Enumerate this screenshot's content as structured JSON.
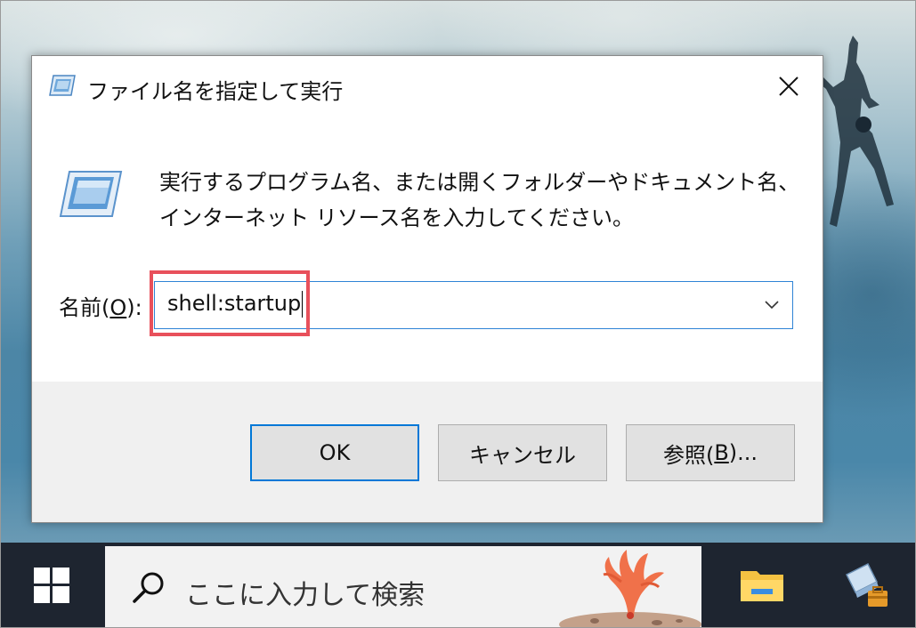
{
  "dialog": {
    "title": "ファイル名を指定して実行",
    "description": "実行するプログラム名、または開くフォルダーやドキュメント名、インターネット リソース名を入力してください。",
    "name_label_prefix": "名前(",
    "name_label_key": "O",
    "name_label_suffix": "):",
    "command_value": "shell:startup",
    "buttons": {
      "ok": "OK",
      "cancel": "キャンセル",
      "browse_prefix": "参照(",
      "browse_key": "B",
      "browse_suffix": ")..."
    },
    "icons": {
      "title": "run-icon",
      "close": "close-icon",
      "dropdown": "chevron-down-icon"
    },
    "highlight_color": "#e8505b"
  },
  "taskbar": {
    "search_placeholder": "ここに入力して検索",
    "icons": [
      "windows-start-icon",
      "search-icon",
      "file-explorer-icon",
      "control-panel-icon"
    ]
  }
}
